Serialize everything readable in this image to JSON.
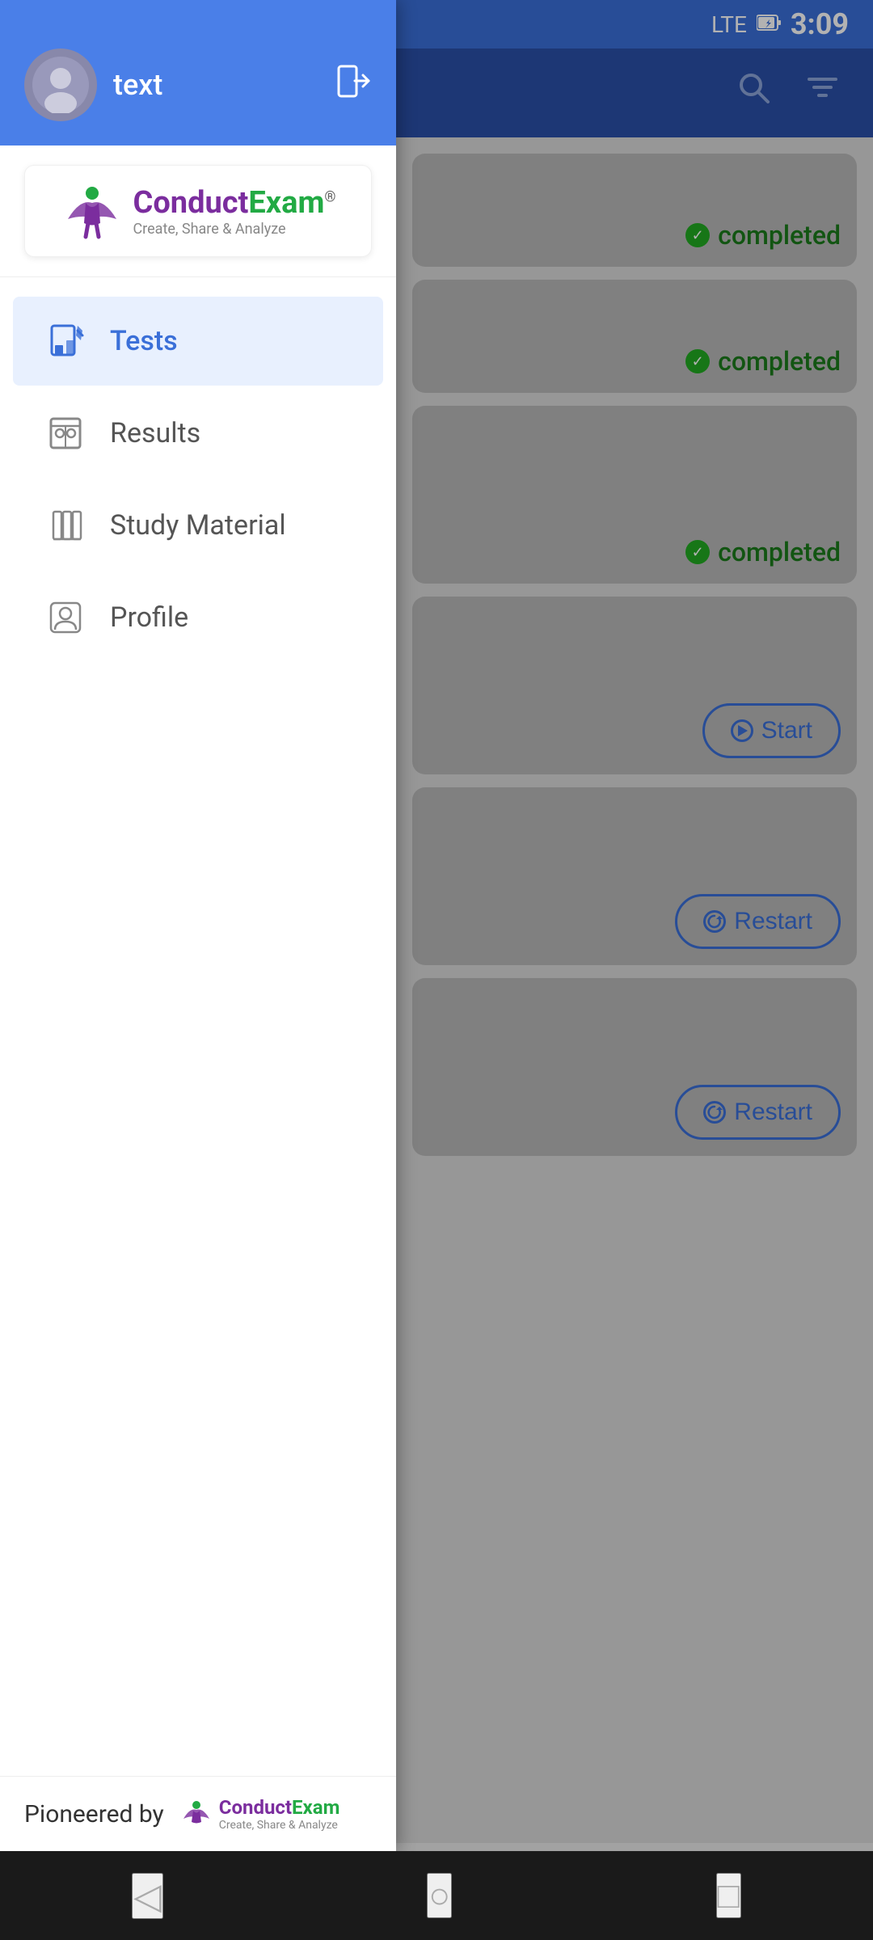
{
  "statusBar": {
    "time": "3:09",
    "batteryIcon": "🔋",
    "signalIcon": "LTE"
  },
  "header": {
    "searchIcon": "search",
    "filterIcon": "filter"
  },
  "drawer": {
    "user": {
      "name": "text",
      "avatarAlt": "user avatar"
    },
    "logoutIcon": "logout",
    "logo": {
      "brandFirst": "Conduct",
      "brandSecond": "Exam",
      "tagline": "Create, Share & Analyze",
      "registered": "®"
    },
    "navItems": [
      {
        "id": "tests",
        "label": "Tests",
        "active": true
      },
      {
        "id": "results",
        "label": "Results",
        "active": false
      },
      {
        "id": "study-material",
        "label": "Study Material",
        "active": false
      },
      {
        "id": "profile",
        "label": "Profile",
        "active": false
      }
    ],
    "footer": {
      "pioneeredBy": "Pioneered by",
      "brandFirst": "Conduct",
      "brandSecond": "Exam",
      "tagline": "Create, Share & Analyze"
    }
  },
  "cards": [
    {
      "status": "completed",
      "type": "completed"
    },
    {
      "status": "completed",
      "type": "completed"
    },
    {
      "status": "completed",
      "type": "completed"
    },
    {
      "status": "Start",
      "type": "start"
    },
    {
      "status": "Restart",
      "type": "restart"
    },
    {
      "status": "Restart",
      "type": "restart"
    }
  ],
  "navBar": {
    "backIcon": "◁",
    "homeIcon": "○",
    "recentIcon": "□"
  }
}
